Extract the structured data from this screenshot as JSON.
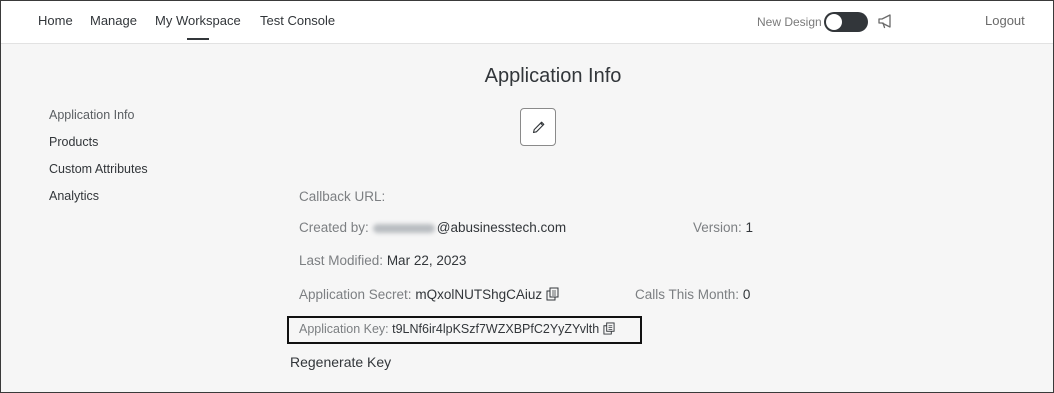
{
  "topnav": {
    "home": "Home",
    "manage": "Manage",
    "my_workspace": "My Workspace",
    "test_console": "Test Console",
    "new_design_label": "New Design",
    "logout": "Logout"
  },
  "page": {
    "title": "Application Info"
  },
  "sidebar": {
    "items": [
      {
        "label": "Application Info"
      },
      {
        "label": "Products"
      },
      {
        "label": "Custom Attributes"
      },
      {
        "label": "Analytics"
      }
    ]
  },
  "details": {
    "callback_label": "Callback URL:",
    "created_by_label": "Created by:",
    "created_by_value": "@abusinesstech.com",
    "version_label": "Version:",
    "version_value": "1",
    "last_modified_label": "Last Modified:",
    "last_modified_value": "Mar 22, 2023",
    "secret_label": "Application Secret:",
    "secret_value": "mQxolNUTShgCAiuz",
    "calls_label": "Calls This Month:",
    "calls_value": "0",
    "key_label": "Application Key:",
    "key_value": "t9LNf6ir4lpKSzf7WZXBPfC2YyZYvlth"
  },
  "actions": {
    "regenerate_key": "Regenerate Key"
  },
  "icons": {
    "edit": "pencil-icon",
    "copy": "copy-icon",
    "announce": "megaphone-icon"
  },
  "colors": {
    "toggle_track": "#32363a",
    "highlight_border": "#111111"
  }
}
